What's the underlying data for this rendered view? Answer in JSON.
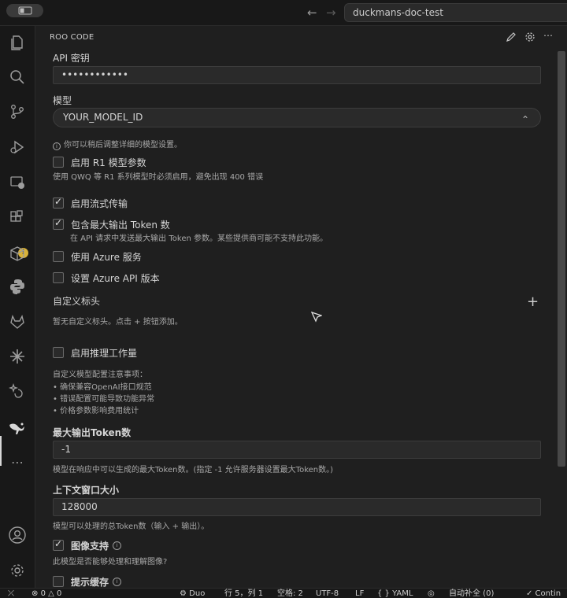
{
  "titlebar": {
    "search_text": "duckmans-doc-test",
    "back_icon": "arrow-left-icon",
    "forward_icon": "arrow-right-icon"
  },
  "activity_bar": {
    "icons": [
      "explorer-icon",
      "search-icon",
      "source-control-icon",
      "run-debug-icon",
      "remote-explorer-icon",
      "extensions-icon",
      "containers-icon",
      "python-icon",
      "gitlab-icon",
      "sparkle-icon",
      "ai-assistant-icon",
      "roo-kangaroo-icon",
      "more-icon",
      "account-icon",
      "settings-gear-icon"
    ],
    "warning_badge": "!"
  },
  "panel": {
    "title": "ROO CODE",
    "api_key": {
      "label": "API 密钥",
      "value": "••••••••••••"
    },
    "model": {
      "label": "模型",
      "value": "YOUR_MODEL_ID",
      "hint": "你可以稍后调整详细的模型设置。"
    },
    "r1": {
      "label": "启用 R1 模型参数",
      "checked": false,
      "hint": "使用 QWQ 等 R1 系列模型时必须启用，避免出现 400 错误"
    },
    "streaming": {
      "label": "启用流式传输",
      "checked": true
    },
    "max_output": {
      "label": "包含最大输出 Token 数",
      "checked": true,
      "hint": "在 API 请求中发送最大输出 Token 参数。某些提供商可能不支持此功能。"
    },
    "azure": {
      "label": "使用 Azure 服务",
      "checked": false
    },
    "azure_version": {
      "label": "设置 Azure API 版本",
      "checked": false
    },
    "custom_headers": {
      "label": "自定义标头",
      "hint": "暂无自定义标头。点击 + 按钮添加。"
    },
    "reasoning": {
      "label": "启用推理工作量",
      "checked": false
    },
    "notes": {
      "title": "自定义模型配置注意事项：",
      "items": [
        "• 确保兼容OpenAI接口规范",
        "• 错误配置可能导致功能异常",
        "• 价格参数影响费用统计"
      ]
    },
    "max_tokens": {
      "label": "最大输出Token数",
      "value": "-1",
      "hint": "模型在响应中可以生成的最大Token数。(指定 -1 允许服务器设置最大Token数。)"
    },
    "context_window": {
      "label": "上下文窗口大小",
      "value": "128000",
      "hint": "模型可以处理的总Token数（输入 + 输出）。"
    },
    "image_support": {
      "label": "图像支持",
      "checked": true,
      "hint": "此模型是否能够处理和理解图像?"
    },
    "prompt_cache": {
      "label": "提示缓存",
      "checked": false
    }
  },
  "statusbar": {
    "problems_errors": "0",
    "problems_warnings": "0",
    "duo": "Duo",
    "position": "行 5，列 1",
    "spaces": "空格: 2",
    "encoding": "UTF-8",
    "eol": "LF",
    "language": "{ } YAML",
    "autocomplete": "自动补全 (0)",
    "continue": "✓ Contin"
  }
}
